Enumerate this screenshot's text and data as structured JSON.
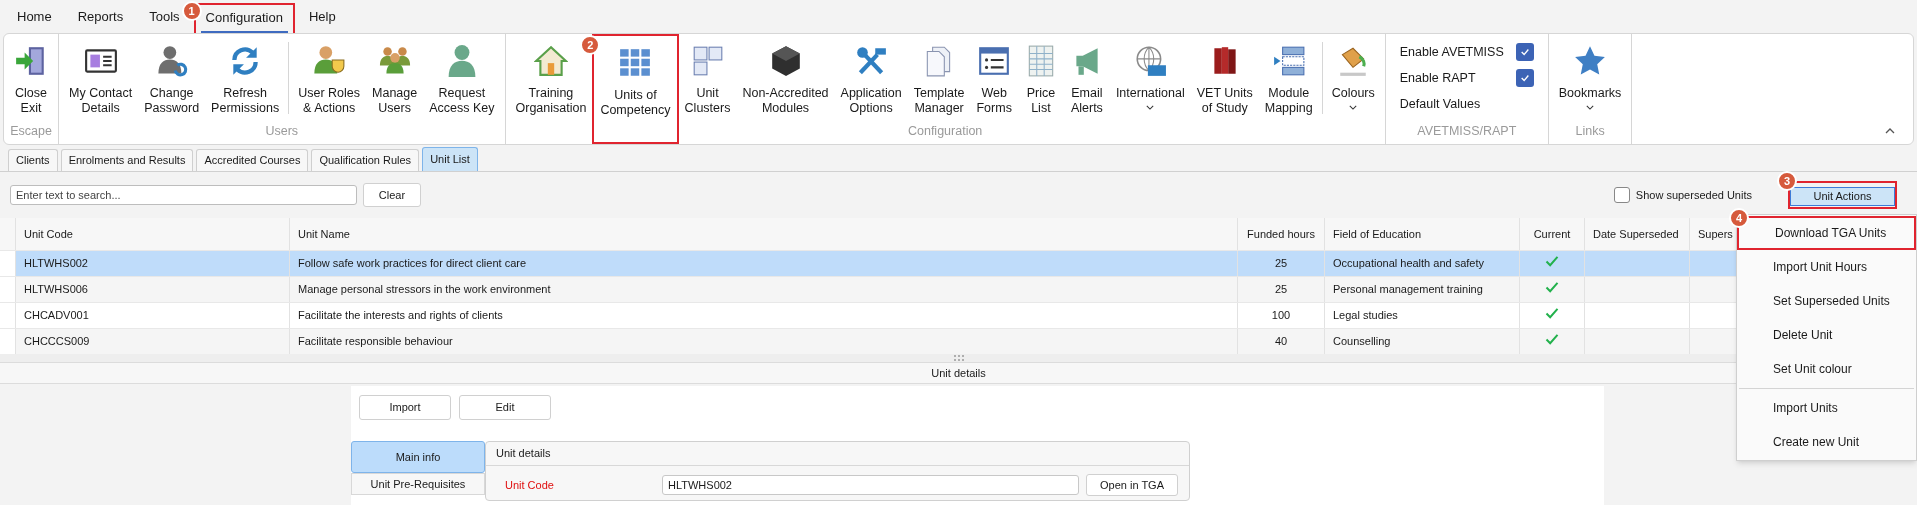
{
  "menu_bar": [
    {
      "label": "Home",
      "selected": false
    },
    {
      "label": "Reports",
      "selected": false
    },
    {
      "label": "Tools",
      "selected": false
    },
    {
      "label": "Configuration",
      "selected": true,
      "callout": "1"
    },
    {
      "label": "Help",
      "selected": false
    }
  ],
  "ribbon": {
    "groups": [
      {
        "label": "Escape",
        "kind": "buttons",
        "buttons": [
          {
            "lines": [
              "Close",
              "Exit"
            ]
          }
        ]
      },
      {
        "label": "Users",
        "kind": "buttons",
        "buttons": [
          {
            "lines": [
              "My Contact",
              "Details"
            ]
          },
          {
            "lines": [
              "Change",
              "Password"
            ]
          },
          {
            "lines": [
              "Refresh",
              "Permissions"
            ]
          },
          {
            "lines": [
              "User Roles",
              "& Actions"
            ],
            "separator_before": true
          },
          {
            "lines": [
              "Manage",
              "Users"
            ]
          },
          {
            "lines": [
              "Request",
              "Access Key"
            ]
          }
        ]
      },
      {
        "label": "Configuration",
        "kind": "buttons",
        "buttons": [
          {
            "lines": [
              "Training",
              "Organisation"
            ]
          },
          {
            "lines": [
              "Units of",
              "Competency"
            ],
            "callout": "2"
          },
          {
            "lines": [
              "Unit",
              "Clusters"
            ]
          },
          {
            "lines": [
              "Non-Accredited",
              "Modules"
            ]
          },
          {
            "lines": [
              "Application",
              "Options"
            ]
          },
          {
            "lines": [
              "Template",
              "Manager"
            ]
          },
          {
            "lines": [
              "Web",
              "Forms"
            ]
          },
          {
            "lines": [
              "Price",
              "List"
            ]
          },
          {
            "lines": [
              "Email",
              "Alerts"
            ]
          },
          {
            "lines": [
              "International"
            ],
            "dropdown": true
          },
          {
            "lines": [
              "VET Units",
              "of Study"
            ]
          },
          {
            "lines": [
              "Module",
              "Mapping"
            ]
          },
          {
            "lines": [
              "Colours"
            ],
            "dropdown": true,
            "separator_before": true
          }
        ]
      },
      {
        "label": "AVETMISS/RAPT",
        "kind": "toggles",
        "toggles": [
          {
            "label": "Enable AVETMISS",
            "checked": true
          },
          {
            "label": "Enable RAPT",
            "checked": true
          }
        ],
        "command": "Default Values"
      },
      {
        "label": "Links",
        "kind": "buttons",
        "buttons": [
          {
            "lines": [
              "Bookmarks"
            ],
            "dropdown": true
          }
        ]
      }
    ]
  },
  "doc_tabs": [
    {
      "label": "Clients",
      "selected": false
    },
    {
      "label": "Enrolments and Results",
      "selected": false
    },
    {
      "label": "Accredited Courses",
      "selected": false
    },
    {
      "label": "Qualification Rules",
      "selected": false
    },
    {
      "label": "Unit List",
      "selected": true
    }
  ],
  "search": {
    "placeholder": "Enter text to search...",
    "clear_button": "Clear"
  },
  "show_superseded": {
    "label": "Show superseded Units",
    "checked": false
  },
  "unit_actions": {
    "label": "Unit Actions",
    "callout": "3",
    "menu": [
      {
        "label": "Download TGA Units",
        "callout": "4"
      },
      {
        "label": "Import Unit Hours"
      },
      {
        "label": "Set Superseded Units"
      },
      {
        "label": "Delete Unit"
      },
      {
        "label": "Set Unit colour"
      },
      {
        "label": "Import Units",
        "separator_before": true
      },
      {
        "label": "Create new Unit"
      }
    ]
  },
  "table": {
    "columns": [
      "Unit Code",
      "Unit Name",
      "Funded hours",
      "Field of Education",
      "Current",
      "Date Superseded",
      "Supers"
    ],
    "rows": [
      {
        "cells": [
          "HLTWHS002",
          "Follow safe work practices for direct client care",
          "25",
          "Occupational health and safety"
        ],
        "current": true,
        "selected": true
      },
      {
        "cells": [
          "HLTWHS006",
          "Manage personal stressors in the work environment",
          "25",
          "Personal management training"
        ],
        "current": true,
        "selected": false
      },
      {
        "cells": [
          "CHCADV001",
          "Facilitate the interests and rights of clients",
          "100",
          "Legal studies"
        ],
        "current": true,
        "selected": false
      },
      {
        "cells": [
          "CHCCCS009",
          "Facilitate responsible behaviour",
          "40",
          "Counselling"
        ],
        "current": true,
        "selected": false
      }
    ]
  },
  "details": {
    "title": "Unit details",
    "buttons": [
      "Import",
      "Edit"
    ],
    "side_tabs": [
      {
        "label": "Main info",
        "selected": true
      },
      {
        "label": "Unit Pre-Requisites",
        "selected": false
      }
    ],
    "group_title": "Unit details",
    "fields": [
      {
        "label": "Unit Code",
        "value": "HLTWHS002",
        "required": true
      }
    ],
    "open_button": "Open in TGA"
  }
}
